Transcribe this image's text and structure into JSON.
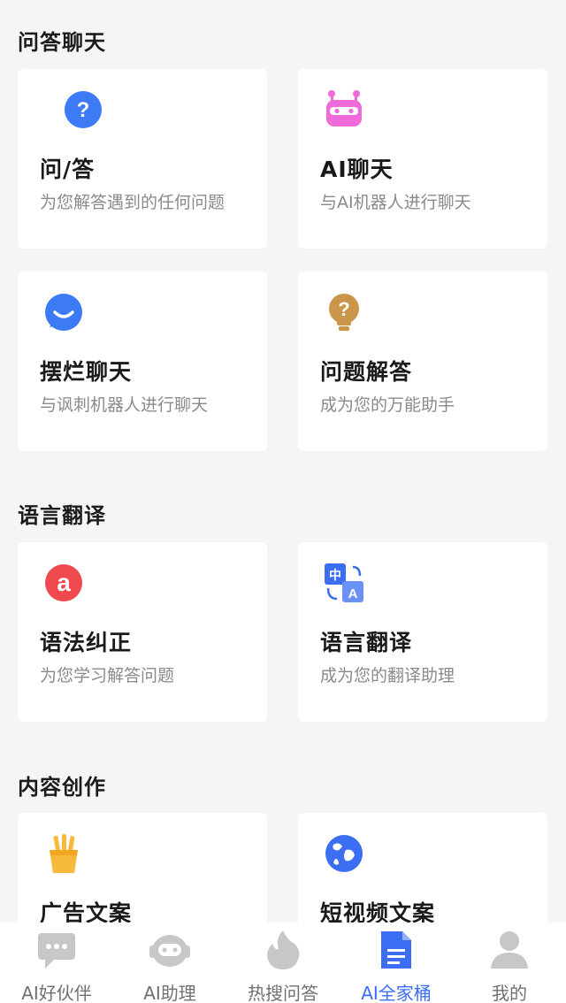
{
  "sections": [
    {
      "title": "问答聊天",
      "cards": [
        {
          "icon": "question-bubble-icon",
          "title": "问/答",
          "desc": "为您解答遇到的任何问题"
        },
        {
          "icon": "robot-icon",
          "title": "AI聊天",
          "desc": "与AI机器人进行聊天"
        },
        {
          "icon": "smile-bubble-icon",
          "title": "摆烂聊天",
          "desc": "与讽刺机器人进行聊天"
        },
        {
          "icon": "lightbulb-icon",
          "title": "问题解答",
          "desc": "成为您的万能助手"
        }
      ]
    },
    {
      "title": "语言翻译",
      "cards": [
        {
          "icon": "letter-a-icon",
          "title": "语法纠正",
          "desc": "为您学习解答问题"
        },
        {
          "icon": "translate-icon",
          "title": "语言翻译",
          "desc": "成为您的翻译助理"
        }
      ]
    },
    {
      "title": "内容创作",
      "cards": [
        {
          "icon": "fries-icon",
          "title": "广告文案",
          "desc": ""
        },
        {
          "icon": "globe-icon",
          "title": "短视频文案",
          "desc": ""
        }
      ]
    }
  ],
  "tabbar": {
    "items": [
      {
        "icon": "chat-bubble-icon",
        "label": "AI好伙伴",
        "active": false
      },
      {
        "icon": "robot-head-icon",
        "label": "AI助理",
        "active": false
      },
      {
        "icon": "flame-icon",
        "label": "热搜问答",
        "active": false
      },
      {
        "icon": "document-icon",
        "label": "AI全家桶",
        "active": true
      },
      {
        "icon": "person-icon",
        "label": "我的",
        "active": false
      }
    ]
  },
  "colors": {
    "accent": "#3b6ef2",
    "question_blue": "#3d7af5",
    "robot_pink": "#f06bd9",
    "light_gold": "#c9964a",
    "letter_red": "#f0484f",
    "fries_yellow": "#f7b93a",
    "globe_blue": "#3b6ef2",
    "tab_inactive": "#c7c7c7"
  }
}
